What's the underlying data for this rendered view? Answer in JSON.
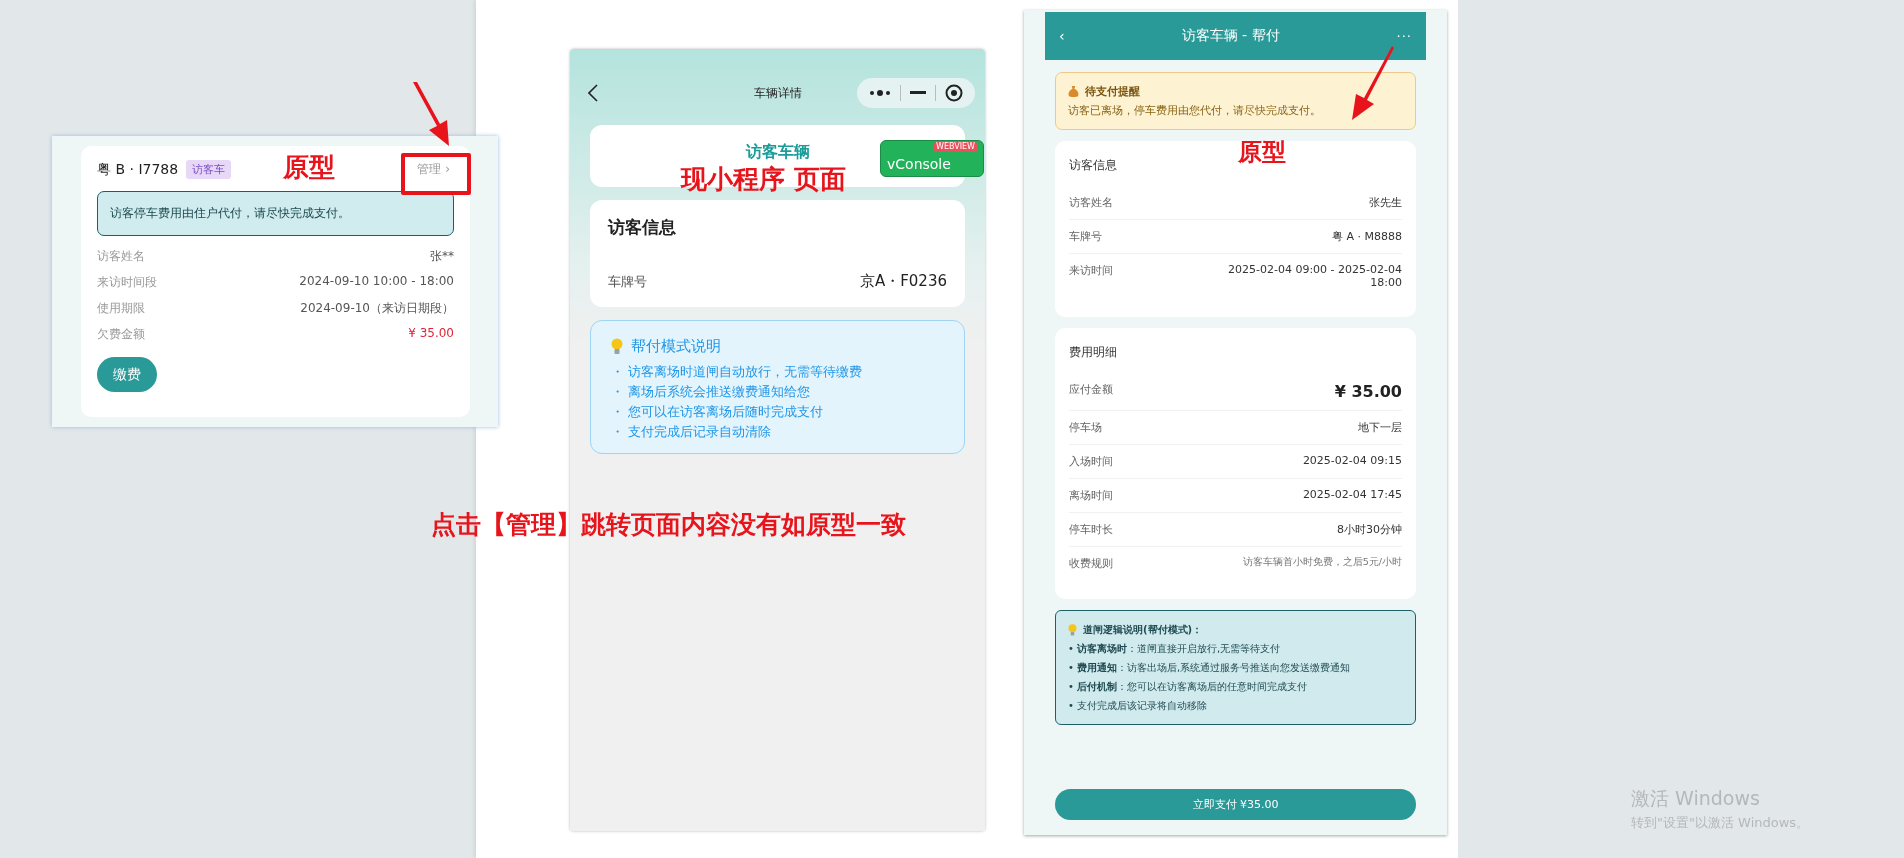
{
  "prototype_card": {
    "plate": "粤 B · I7788",
    "tag": "访客车",
    "manage_link": "管理 ›",
    "notice": "访客停车费用由住户代付，请尽快完成支付。",
    "rows": [
      {
        "label": "访客姓名",
        "value": "张**",
        "kind": "plain"
      },
      {
        "label": "来访时间段",
        "value": "2024-09-10 10:00 - 18:00",
        "kind": "plain"
      },
      {
        "label": "使用期限",
        "value": "2024-09-10（来访日期段）",
        "kind": "plain"
      },
      {
        "label": "欠费金额",
        "value": "¥ 35.00",
        "kind": "amount"
      }
    ],
    "pay_button": "缴费"
  },
  "current_page": {
    "nav_title": "车辆详情",
    "header_title": "访客车辆",
    "vconsole": "vConsole",
    "vconsole_ribbon": "WEBVIEW",
    "info_title": "访客信息",
    "rows": [
      {
        "label": "车牌号",
        "value": "京A・F0236"
      }
    ],
    "help": {
      "title": "帮付模式说明",
      "items": [
        "・ 访客离场时道闸自动放行，无需等待缴费",
        "・ 离场后系统会推送缴费通知给您",
        "・ 您可以在访客离场后随时完成支付",
        "・ 支付完成后记录自动清除"
      ]
    }
  },
  "prototype_page": {
    "back": "‹",
    "nav_title": "访客车辆 - 帮付",
    "more": "···",
    "alert": {
      "title": "待支付提醒",
      "text": "访客已离场，停车费用由您代付，请尽快完成支付。"
    },
    "visitor": {
      "title": "访客信息",
      "rows": [
        {
          "label": "访客姓名",
          "value": "张先生",
          "kind": "plain"
        },
        {
          "label": "车牌号",
          "value": "粤 A · M8888",
          "kind": "plain"
        },
        {
          "label": "来访时间",
          "value": "2025-02-04 09:00 - 2025-02-04 18:00",
          "kind": "plain"
        }
      ]
    },
    "fees": {
      "title": "费用明细",
      "rows": [
        {
          "label": "应付金额",
          "value": "¥ 35.00",
          "kind": "amount"
        },
        {
          "label": "停车场",
          "value": "地下一层",
          "kind": "plain"
        },
        {
          "label": "入场时间",
          "value": "2025-02-04 09:15",
          "kind": "plain"
        },
        {
          "label": "离场时间",
          "value": "2025-02-04 17:45",
          "kind": "plain"
        },
        {
          "label": "停车时长",
          "value": "8小时30分钟",
          "kind": "plain"
        },
        {
          "label": "收费规则",
          "value": "访客车辆首小时免费，之后5元/小时",
          "kind": "note"
        }
      ]
    },
    "gate": {
      "title": "道闸逻辑说明(帮付模式)：",
      "items": [
        "• **访客离场时**：道闸直接开启放行,无需等待支付",
        "• **费用通知**：访客出场后,系统通过服务号推送向您发送缴费通知",
        "• **后付机制**：您可以在访客离场后的任意时间完成支付",
        "• 支付完成后该记录将自动移除"
      ]
    },
    "pay_button": "立即支付 ¥35.00"
  },
  "annotations": {
    "left": "原型",
    "current": "现小程序 页面",
    "right": "原型",
    "main": "点击【管理】跳转页面内容没有如原型一致"
  },
  "os_watermark": {
    "title": "激活 Windows",
    "subtitle": "转到\"设置\"以激活 Windows。"
  }
}
